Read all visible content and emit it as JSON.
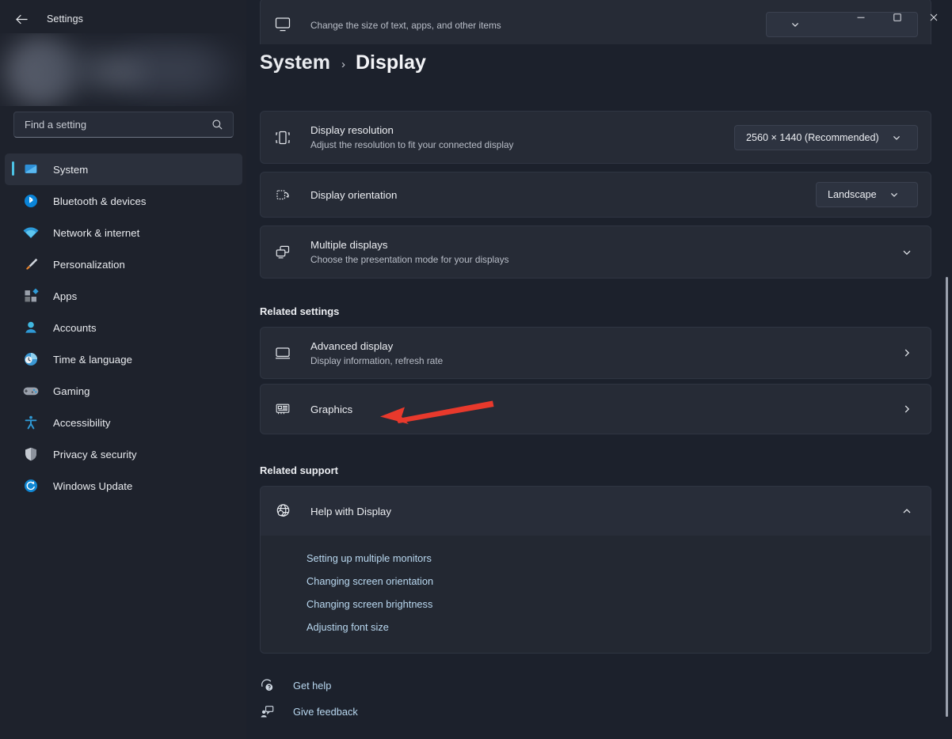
{
  "window": {
    "app_title": "Settings",
    "back_icon": "arrow-left-icon",
    "controls": {
      "minimize": "minimize-icon",
      "maximize": "maximize-icon",
      "close": "close-icon"
    }
  },
  "sidebar": {
    "search": {
      "placeholder": "Find a setting",
      "value": "",
      "icon": "search-icon"
    },
    "items": [
      {
        "label": "System",
        "icon": "system-icon",
        "selected": true
      },
      {
        "label": "Bluetooth & devices",
        "icon": "bluetooth-icon",
        "selected": false
      },
      {
        "label": "Network & internet",
        "icon": "network-icon",
        "selected": false
      },
      {
        "label": "Personalization",
        "icon": "paintbrush-icon",
        "selected": false
      },
      {
        "label": "Apps",
        "icon": "apps-icon",
        "selected": false
      },
      {
        "label": "Accounts",
        "icon": "accounts-icon",
        "selected": false
      },
      {
        "label": "Time & language",
        "icon": "clock-icon",
        "selected": false
      },
      {
        "label": "Gaming",
        "icon": "gamepad-icon",
        "selected": false
      },
      {
        "label": "Accessibility",
        "icon": "accessibility-icon",
        "selected": false
      },
      {
        "label": "Privacy & security",
        "icon": "shield-icon",
        "selected": false
      },
      {
        "label": "Windows Update",
        "icon": "update-icon",
        "selected": false
      }
    ]
  },
  "breadcrumb": {
    "root": "System",
    "separator": "›",
    "current": "Display"
  },
  "main": {
    "scale_row": {
      "subtitle": "Change the size of text, apps, and other items",
      "icon": "scale-icon"
    },
    "resolution_row": {
      "title": "Display resolution",
      "subtitle": "Adjust the resolution to fit your connected display",
      "icon": "resolution-icon",
      "value": "2560 × 1440 (Recommended)",
      "chevron": "chevron-down-icon"
    },
    "orientation_row": {
      "title": "Display orientation",
      "icon": "orientation-icon",
      "value": "Landscape",
      "chevron": "chevron-down-icon"
    },
    "multiple_displays_row": {
      "title": "Multiple displays",
      "subtitle": "Choose the presentation mode for your displays",
      "icon": "multiple-displays-icon",
      "chevron": "chevron-down-icon"
    },
    "related_settings_header": "Related settings",
    "advanced_display_row": {
      "title": "Advanced display",
      "subtitle": "Display information, refresh rate",
      "icon": "monitor-icon",
      "chevron": "chevron-right-icon"
    },
    "graphics_row": {
      "title": "Graphics",
      "icon": "graphics-card-icon",
      "chevron": "chevron-right-icon"
    },
    "related_support_header": "Related support",
    "help_card": {
      "title": "Help with Display",
      "icon": "help-globe-icon",
      "chevron": "chevron-up-icon",
      "links": [
        "Setting up multiple monitors",
        "Changing screen orientation",
        "Changing screen brightness",
        "Adjusting font size"
      ]
    },
    "footer": [
      {
        "label": "Get help",
        "icon": "get-help-icon"
      },
      {
        "label": "Give feedback",
        "icon": "give-feedback-icon"
      }
    ]
  },
  "annotation": {
    "type": "arrow-left",
    "color": "#e8392c",
    "points_to": "Graphics"
  },
  "colors": {
    "accent": "#4cc2e4",
    "window_bg": "#1c212c",
    "sidebar_bg": "#1e222c",
    "card_bg": "#262b36",
    "link": "#b9d8f0",
    "annotation_red": "#e8392c"
  }
}
